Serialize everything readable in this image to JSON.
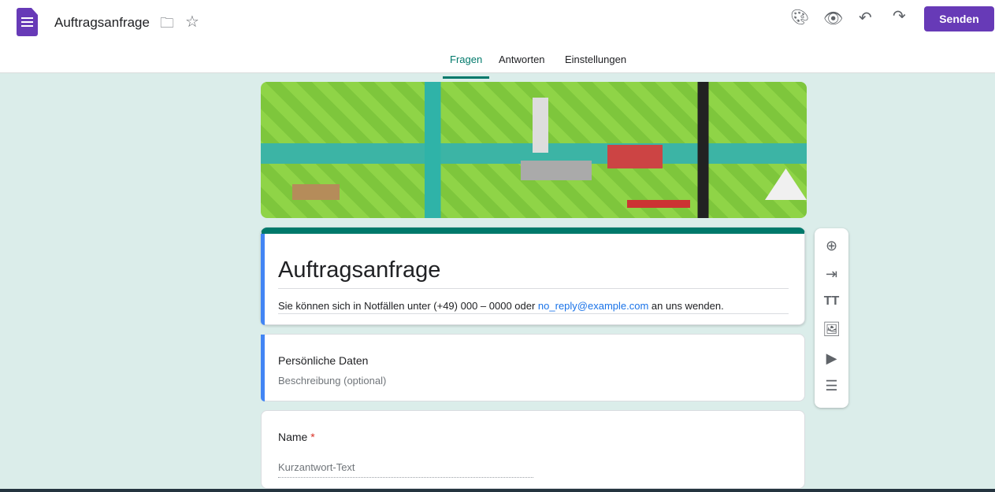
{
  "header": {
    "title": "Auftragsanfrage",
    "send_label": "Senden"
  },
  "tabs": [
    {
      "label": "Fragen"
    },
    {
      "label": "Antworten"
    },
    {
      "label": "Einstellungen"
    }
  ],
  "form": {
    "title": "Auftragsanfrage",
    "description_pre": "Sie können sich in Notfällen unter (+49) 000 – 0000 oder ",
    "email": "no_reply@example.com",
    "description_post": " an uns wenden."
  },
  "section": {
    "title": "Persönliche Daten",
    "description_placeholder": "Beschreibung (optional)"
  },
  "question": {
    "label": "Name",
    "required_mark": "*",
    "placeholder": "Kurzantwort-Text"
  },
  "colors": {
    "accent": "#673ab7",
    "theme": "#00796b",
    "background": "#dbedea"
  }
}
